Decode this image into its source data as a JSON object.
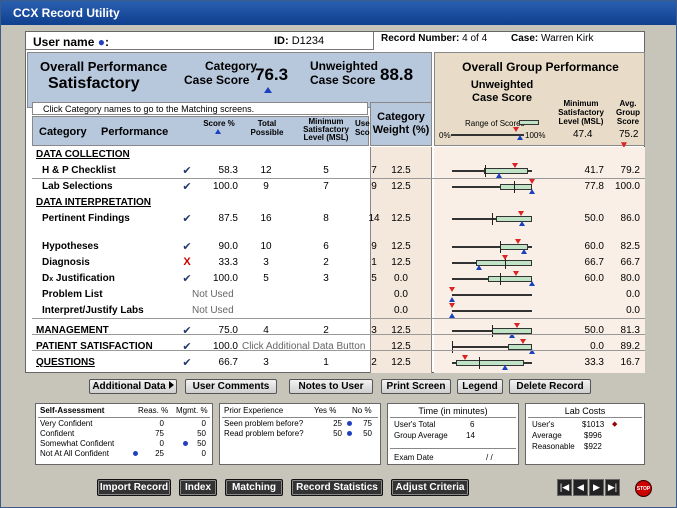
{
  "window": {
    "title": "CCX Record Utility"
  },
  "header": {
    "user_label": "User name",
    "user_dot": "●",
    "user_colon": ":",
    "id_label": "ID:",
    "id_value": "D1234",
    "record_label": "Record Number:",
    "record_value": "4 of 4",
    "case_label": "Case:",
    "case_value": "Warren Kirk"
  },
  "summary": {
    "overall_label": "Overall Performance",
    "overall_value": "Satisfactory",
    "category_label_1": "Category",
    "category_label_2": "Case Score",
    "category_value": "76.3",
    "unweighted_label_1": "Unweighted",
    "unweighted_label_2": "Case Score",
    "unweighted_value": "88.8"
  },
  "hint": "Click Category names to go to the Matching screens.",
  "columns": {
    "category": "Category",
    "performance": "Performance",
    "score": "Score %",
    "total": "Total Possible",
    "msl": "Minimum Satisfactory Level (MSL)",
    "user_score": "User Score",
    "weight": "Category Weight (%)"
  },
  "group": {
    "title": "Overall Group Performance",
    "unweighted": "Unweighted Case Score",
    "msl_label": "Minimum Satisfactory Level (MSL)",
    "avg_label": "Avg. Group Score",
    "range_label": "Range of Scores",
    "zero": "0%",
    "hundred": "100%",
    "msl_value": "47.4",
    "avg_value": "75.2",
    "colors": {
      "range": "#bfe3c4",
      "user_marker": "#1a3fc0",
      "group_marker": "#d22222"
    }
  },
  "rows": [
    {
      "type": "section",
      "name": "DATA COLLECTION"
    },
    {
      "type": "item",
      "name": "H & P Checklist",
      "check": "✔",
      "score": "58.3",
      "total": "12",
      "msl": "5",
      "user": "7",
      "weight": "12.5",
      "group_msl": "41.7",
      "group_avg": "79.2",
      "range": [
        0.4,
        0.95
      ],
      "user_pct": 58.3,
      "avg_pct": 79.2
    },
    {
      "type": "item",
      "name": "Lab Selections",
      "check": "✔",
      "score": "100.0",
      "total": "9",
      "msl": "7",
      "user": "9",
      "weight": "12.5",
      "group_msl": "77.8",
      "group_avg": "100.0",
      "range": [
        0.6,
        1.0
      ],
      "user_pct": 100.0,
      "avg_pct": 100.0
    },
    {
      "type": "section",
      "name": "DATA INTERPRETATION"
    },
    {
      "type": "item",
      "name": "Pertinent Findings",
      "check": "✔",
      "score": "87.5",
      "total": "16",
      "msl": "8",
      "user": "14",
      "weight": "12.5",
      "group_msl": "50.0",
      "group_avg": "86.0",
      "range": [
        0.55,
        1.0
      ],
      "user_pct": 87.5,
      "avg_pct": 86.0
    },
    {
      "type": "item",
      "name": "Hypotheses",
      "check": "✔",
      "score": "90.0",
      "total": "10",
      "msl": "6",
      "user": "9",
      "weight": "12.5",
      "group_msl": "60.0",
      "group_avg": "82.5",
      "range": [
        0.6,
        0.95
      ],
      "user_pct": 90.0,
      "avg_pct": 82.5
    },
    {
      "type": "item",
      "name": "Diagnosis",
      "check": "X",
      "score": "33.3",
      "total": "3",
      "msl": "2",
      "user": "1",
      "weight": "12.5",
      "group_msl": "66.7",
      "group_avg": "66.7",
      "range": [
        0.3,
        1.0
      ],
      "user_pct": 33.3,
      "avg_pct": 66.7
    },
    {
      "type": "item",
      "name": "Dx Justification",
      "check": "✔",
      "score": "100.0",
      "total": "5",
      "msl": "3",
      "user": "5",
      "weight": "0.0",
      "group_msl": "60.0",
      "group_avg": "80.0",
      "range": [
        0.45,
        1.0
      ],
      "user_pct": 100.0,
      "avg_pct": 80.0
    },
    {
      "type": "item",
      "name": "Problem List",
      "check": "",
      "note": "Not Used",
      "weight": "0.0",
      "group_msl": "",
      "group_avg": "0.0",
      "range": [
        0,
        0
      ],
      "user_pct": 0,
      "avg_pct": 0
    },
    {
      "type": "item",
      "name": "Interpret/Justify Labs",
      "check": "",
      "note": "Not Used",
      "weight": "0.0",
      "group_msl": "",
      "group_avg": "0.0",
      "range": [
        0,
        0
      ],
      "user_pct": 0,
      "avg_pct": 0
    },
    {
      "type": "section-item",
      "name": "MANAGEMENT",
      "check": "✔",
      "score": "75.0",
      "total": "4",
      "msl": "2",
      "user": "3",
      "weight": "12.5",
      "group_msl": "50.0",
      "group_avg": "81.3",
      "range": [
        0.5,
        1.0
      ],
      "user_pct": 75.0,
      "avg_pct": 81.3
    },
    {
      "type": "section-item",
      "name": "PATIENT SATISFACTION",
      "check": "✔",
      "score": "100.0",
      "note": "Click Additional Data Button",
      "weight": "12.5",
      "group_msl": "0.0",
      "group_avg": "89.2",
      "range": [
        0.7,
        1.0
      ],
      "user_pct": 100.0,
      "avg_pct": 89.2
    },
    {
      "type": "section-item",
      "name": "QUESTIONS",
      "check": "✔",
      "score": "66.7",
      "total": "3",
      "msl": "1",
      "user": "2",
      "weight": "12.5",
      "group_msl": "33.3",
      "group_avg": "16.7",
      "range": [
        0.05,
        0.9
      ],
      "user_pct": 66.7,
      "avg_pct": 16.7
    }
  ],
  "toolbar": {
    "additional_data": "Additional Data",
    "user_comments": "User Comments",
    "notes_to_user": "Notes to User",
    "print_screen": "Print Screen",
    "legend": "Legend",
    "delete_record": "Delete Record"
  },
  "self_assessment": {
    "title": "Self-Assessment",
    "reas_label": "Reas. %",
    "mgmt_label": "Mgmt. %",
    "rows": [
      {
        "label": "Very Confident",
        "reas": "0",
        "mgmt": "0"
      },
      {
        "label": "Confident",
        "reas": "75",
        "mgmt": "50"
      },
      {
        "label": "Somewhat Confident",
        "reas": "0",
        "mgmt": "50"
      },
      {
        "label": "Not At All Confident",
        "reas": "25",
        "mgmt": "0"
      }
    ]
  },
  "prior_experience": {
    "title": "Prior Experience",
    "yes_label": "Yes %",
    "no_label": "No %",
    "rows": [
      {
        "label": "Seen problem before?",
        "yes": "25",
        "no": "75"
      },
      {
        "label": "Read problem before?",
        "yes": "50",
        "no": "50"
      }
    ]
  },
  "time": {
    "title": "Time (in minutes)",
    "users_total_label": "User's Total",
    "users_total_value": "6",
    "group_avg_label": "Group Average",
    "group_avg_value": "14",
    "exam_date_label": "Exam Date",
    "exam_date_value": "/   /"
  },
  "lab_costs": {
    "title": "Lab Costs",
    "users_label": "User's",
    "users_value": "$1013",
    "average_label": "Average",
    "average_value": "$996",
    "reasonable_label": "Reasonable",
    "reasonable_value": "$922"
  },
  "bottom": {
    "import_record": "Import Record",
    "index": "Index",
    "matching": "Matching",
    "record_statistics": "Record Statistics",
    "adjust_criteria": "Adjust Criteria",
    "nav_first": "|◀",
    "nav_prev": "◀",
    "nav_next": "▶",
    "nav_last": "▶|",
    "stop": "STOP"
  }
}
